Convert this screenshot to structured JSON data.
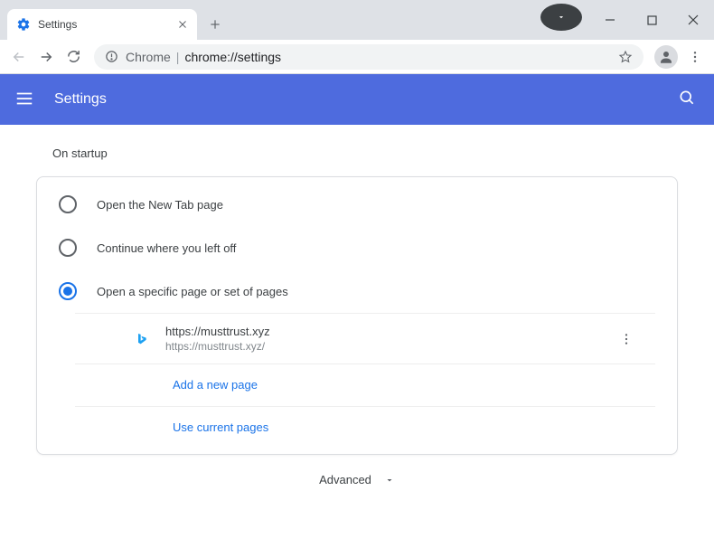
{
  "window": {
    "tab_title": "Settings"
  },
  "omnibox": {
    "host": "Chrome",
    "path": "chrome://settings"
  },
  "header": {
    "title": "Settings"
  },
  "startup": {
    "section_title": "On startup",
    "options": [
      {
        "label": "Open the New Tab page",
        "selected": false
      },
      {
        "label": "Continue where you left off",
        "selected": false
      },
      {
        "label": "Open a specific page or set of pages",
        "selected": true
      }
    ],
    "pages": [
      {
        "title": "https://musttrust.xyz",
        "url": "https://musttrust.xyz/"
      }
    ],
    "add_page_label": "Add a new page",
    "use_current_label": "Use current pages"
  },
  "footer": {
    "advanced_label": "Advanced"
  }
}
